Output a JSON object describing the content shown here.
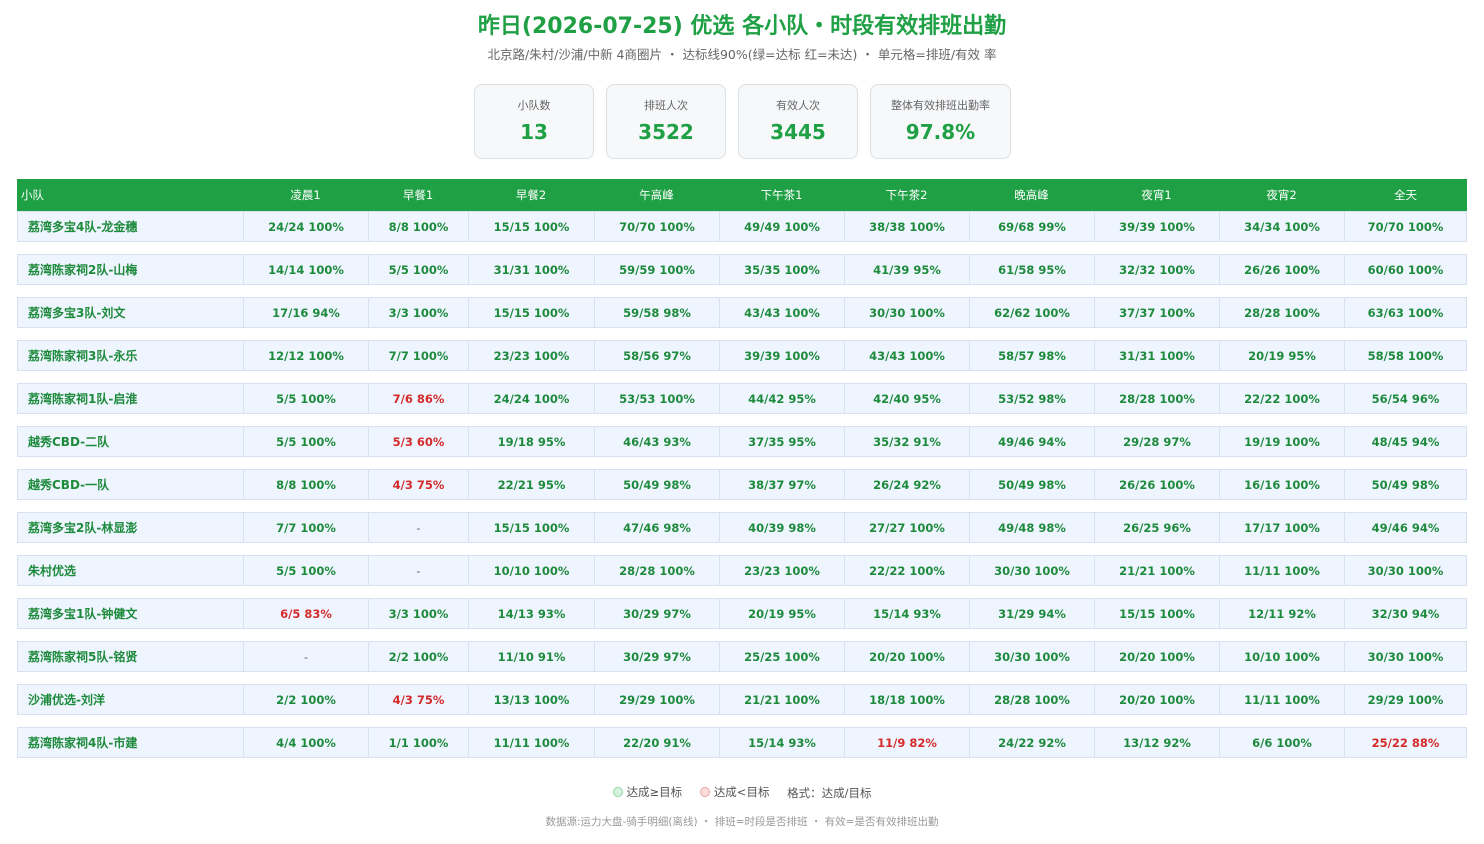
{
  "header": {
    "title": "昨日(2026-07-25) 优选 各小队・时段有效排班出勤",
    "subtitle": "北京路/朱村/沙浦/中新 4商圈片 ・ 达标线90%(绿=达标 红=未达) ・ 单元格=排班/有效 率"
  },
  "kpis": [
    {
      "label": "小队数",
      "value": "13"
    },
    {
      "label": "排班人次",
      "value": "3522"
    },
    {
      "label": "有效人次",
      "value": "3445"
    },
    {
      "label": "整体有效排班出勤率",
      "value": "97.8%"
    }
  ],
  "table": {
    "columns": [
      "小队",
      "凌晨1",
      "早餐1",
      "早餐2",
      "午高峰",
      "下午茶1",
      "下午茶2",
      "晚高峰",
      "夜宵1",
      "夜宵2",
      "全天"
    ],
    "rows": [
      {
        "team": "荔湾多宝4队-龙金穗",
        "cells": [
          "24/24 100%",
          "8/8 100%",
          "15/15 100%",
          "70/70 100%",
          "49/49 100%",
          "38/38 100%",
          "69/68 99%",
          "39/39 100%",
          "34/34 100%",
          "70/70 100%"
        ],
        "bad": []
      },
      {
        "team": "荔湾陈家祠2队-山梅",
        "cells": [
          "14/14 100%",
          "5/5 100%",
          "31/31 100%",
          "59/59 100%",
          "35/35 100%",
          "41/39 95%",
          "61/58 95%",
          "32/32 100%",
          "26/26 100%",
          "60/60 100%"
        ],
        "bad": []
      },
      {
        "team": "荔湾多宝3队-刘文",
        "cells": [
          "17/16 94%",
          "3/3 100%",
          "15/15 100%",
          "59/58 98%",
          "43/43 100%",
          "30/30 100%",
          "62/62 100%",
          "37/37 100%",
          "28/28 100%",
          "63/63 100%"
        ],
        "bad": []
      },
      {
        "team": "荔湾陈家祠3队-永乐",
        "cells": [
          "12/12 100%",
          "7/7 100%",
          "23/23 100%",
          "58/56 97%",
          "39/39 100%",
          "43/43 100%",
          "58/57 98%",
          "31/31 100%",
          "20/19 95%",
          "58/58 100%"
        ],
        "bad": []
      },
      {
        "team": "荔湾陈家祠1队-启淮",
        "cells": [
          "5/5 100%",
          "7/6 86%",
          "24/24 100%",
          "53/53 100%",
          "44/42 95%",
          "42/40 95%",
          "53/52 98%",
          "28/28 100%",
          "22/22 100%",
          "56/54 96%"
        ],
        "bad": [
          1
        ]
      },
      {
        "team": "越秀CBD-二队",
        "cells": [
          "5/5 100%",
          "5/3 60%",
          "19/18 95%",
          "46/43 93%",
          "37/35 95%",
          "35/32 91%",
          "49/46 94%",
          "29/28 97%",
          "19/19 100%",
          "48/45 94%"
        ],
        "bad": [
          1
        ]
      },
      {
        "team": "越秀CBD-一队",
        "cells": [
          "8/8 100%",
          "4/3 75%",
          "22/21 95%",
          "50/49 98%",
          "38/37 97%",
          "26/24 92%",
          "50/49 98%",
          "26/26 100%",
          "16/16 100%",
          "50/49 98%"
        ],
        "bad": [
          1
        ]
      },
      {
        "team": "荔湾多宝2队-林显澎",
        "cells": [
          "7/7 100%",
          "-",
          "15/15 100%",
          "47/46 98%",
          "40/39 98%",
          "27/27 100%",
          "49/48 98%",
          "26/25 96%",
          "17/17 100%",
          "49/46 94%"
        ],
        "bad": []
      },
      {
        "team": "朱村优选",
        "cells": [
          "5/5 100%",
          "-",
          "10/10 100%",
          "28/28 100%",
          "23/23 100%",
          "22/22 100%",
          "30/30 100%",
          "21/21 100%",
          "11/11 100%",
          "30/30 100%"
        ],
        "bad": []
      },
      {
        "team": "荔湾多宝1队-钟健文",
        "cells": [
          "6/5 83%",
          "3/3 100%",
          "14/13 93%",
          "30/29 97%",
          "20/19 95%",
          "15/14 93%",
          "31/29 94%",
          "15/15 100%",
          "12/11 92%",
          "32/30 94%"
        ],
        "bad": [
          0
        ]
      },
      {
        "team": "荔湾陈家祠5队-铭贤",
        "cells": [
          "-",
          "2/2 100%",
          "11/10 91%",
          "30/29 97%",
          "25/25 100%",
          "20/20 100%",
          "30/30 100%",
          "20/20 100%",
          "10/10 100%",
          "30/30 100%"
        ],
        "bad": []
      },
      {
        "team": "沙浦优选-刘洋",
        "cells": [
          "2/2 100%",
          "4/3 75%",
          "13/13 100%",
          "29/29 100%",
          "21/21 100%",
          "18/18 100%",
          "28/28 100%",
          "20/20 100%",
          "11/11 100%",
          "29/29 100%"
        ],
        "bad": [
          1
        ]
      },
      {
        "team": "荔湾陈家祠4队-市建",
        "cells": [
          "4/4 100%",
          "1/1 100%",
          "11/11 100%",
          "22/20 91%",
          "15/14 93%",
          "11/9 82%",
          "24/22 92%",
          "13/12 92%",
          "6/6 100%",
          "25/22 88%"
        ],
        "bad": [
          5,
          9
        ]
      }
    ]
  },
  "legend": {
    "ok_label": "达成≥目标",
    "ng_label": "达成<目标",
    "format_label": "格式：达成/目标"
  },
  "footer": {
    "text": "数据源:运力大盘-骑手明细(离线) ・ 排班=时段是否排班 ・ 有效=是否有效排班出勤"
  },
  "colors": {
    "brand_green": "#1fa045",
    "ok_text": "#1e8a3c",
    "bad_text": "#d42b2b",
    "row_bg": "#eef5ff"
  }
}
